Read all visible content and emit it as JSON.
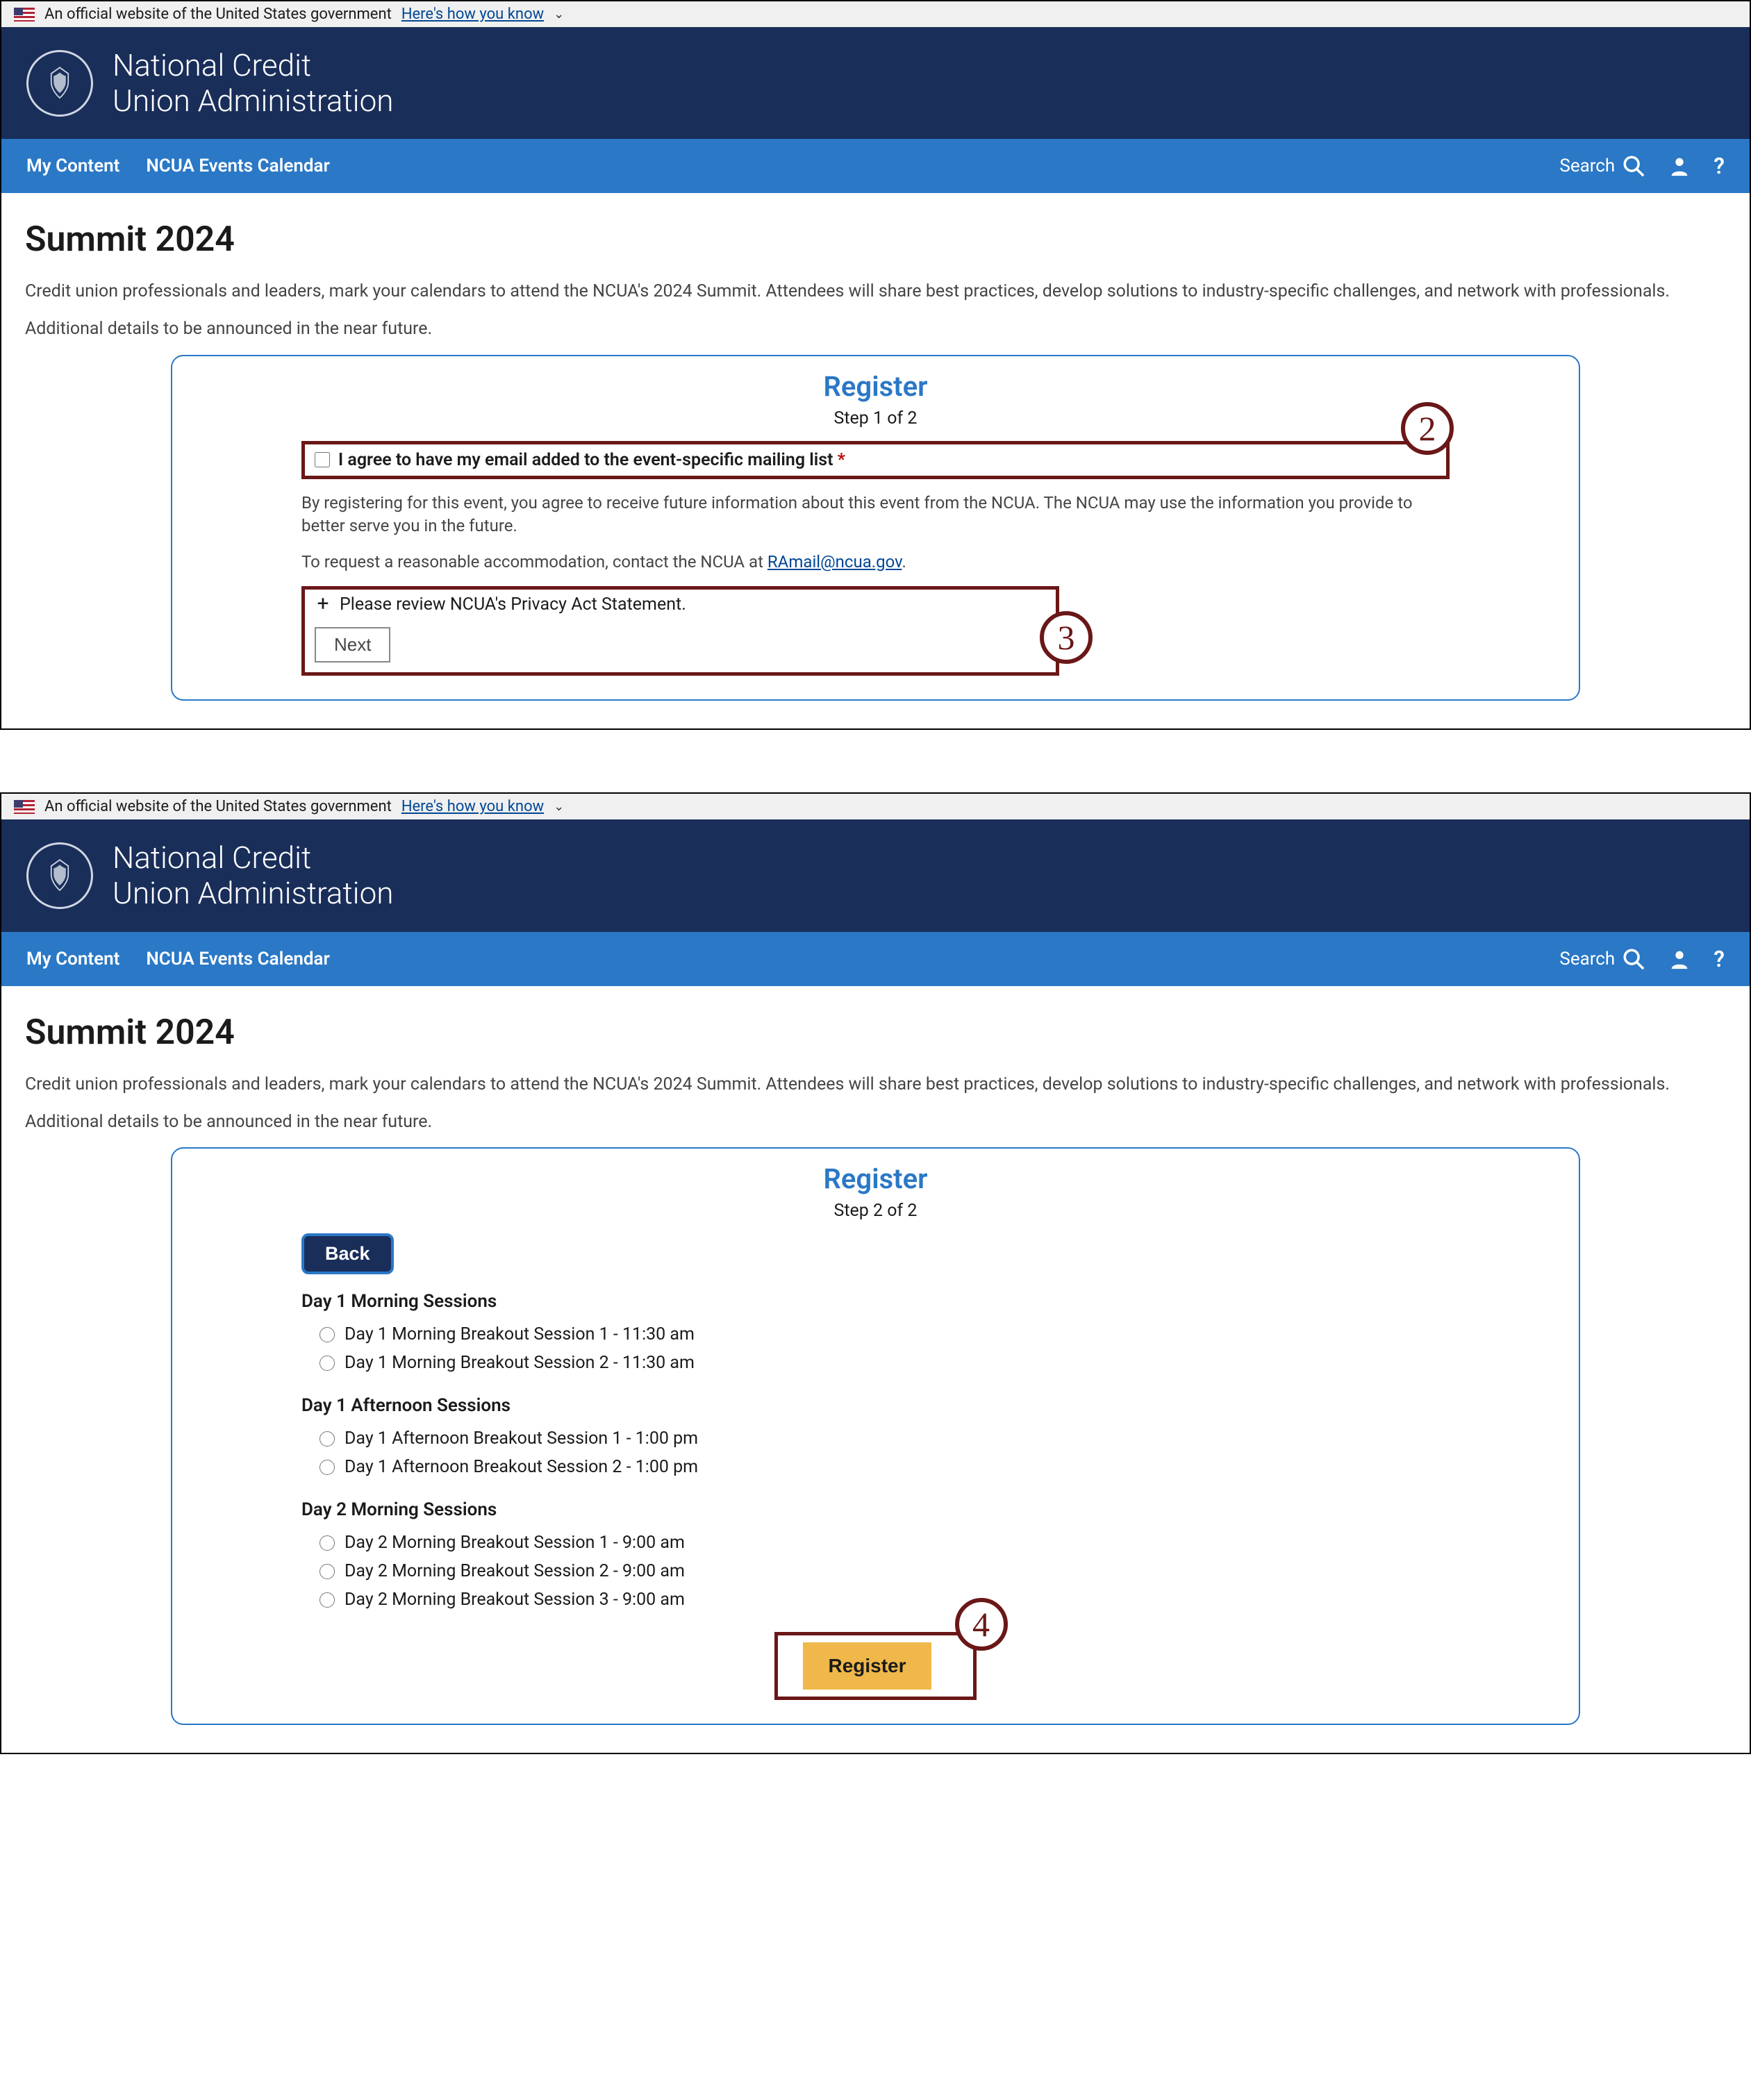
{
  "gov_banner": {
    "text": "An official website of the United States government",
    "link": "Here's how you know"
  },
  "org": {
    "line1": "National Credit",
    "line2": "Union Administration"
  },
  "nav": {
    "item1": "My Content",
    "item2": "NCUA Events Calendar",
    "search": "Search",
    "help": "?"
  },
  "page_title": "Summit 2024",
  "lead": "Credit union professionals and leaders, mark your calendars to attend the NCUA's 2024 Summit. Attendees will share best practices, develop solutions to industry-specific challenges, and network with  professionals.",
  "subtext": "Additional details to be announced in the near future.",
  "register": {
    "title": "Register",
    "step1": "Step 1 of 2",
    "step2": "Step 2 of 2",
    "agree": "I agree to have my email added to the event-specific mailing list",
    "star": "*",
    "body_copy": "By registering for this event, you agree to receive future information about this event from the NCUA. The NCUA may use the information you provide to better serve you in the future.",
    "accommodation_pre": "To request a reasonable accommodation, contact the NCUA at ",
    "accommodation_link": "RAmail@ncua.gov",
    "accommodation_post": ".",
    "privacy": "Please review NCUA's Privacy Act Statement.",
    "next": "Next",
    "back": "Back",
    "register_btn": "Register"
  },
  "sessions": {
    "group1": {
      "title": "Day 1 Morning Sessions",
      "items": [
        "Day 1 Morning Breakout Session 1 - 11:30 am",
        "Day 1 Morning Breakout Session 2 - 11:30 am"
      ]
    },
    "group2": {
      "title": "Day 1 Afternoon Sessions",
      "items": [
        "Day 1 Afternoon Breakout Session 1 - 1:00 pm",
        "Day 1 Afternoon Breakout Session 2 - 1:00 pm"
      ]
    },
    "group3": {
      "title": "Day 2 Morning Sessions",
      "items": [
        "Day 2 Morning Breakout Session 1 - 9:00 am",
        "Day 2 Morning Breakout Session 2 - 9:00 am",
        "Day 2 Morning Breakout Session 3 - 9:00 am"
      ]
    }
  },
  "callouts": {
    "c2": "2",
    "c3": "3",
    "c4": "4"
  }
}
